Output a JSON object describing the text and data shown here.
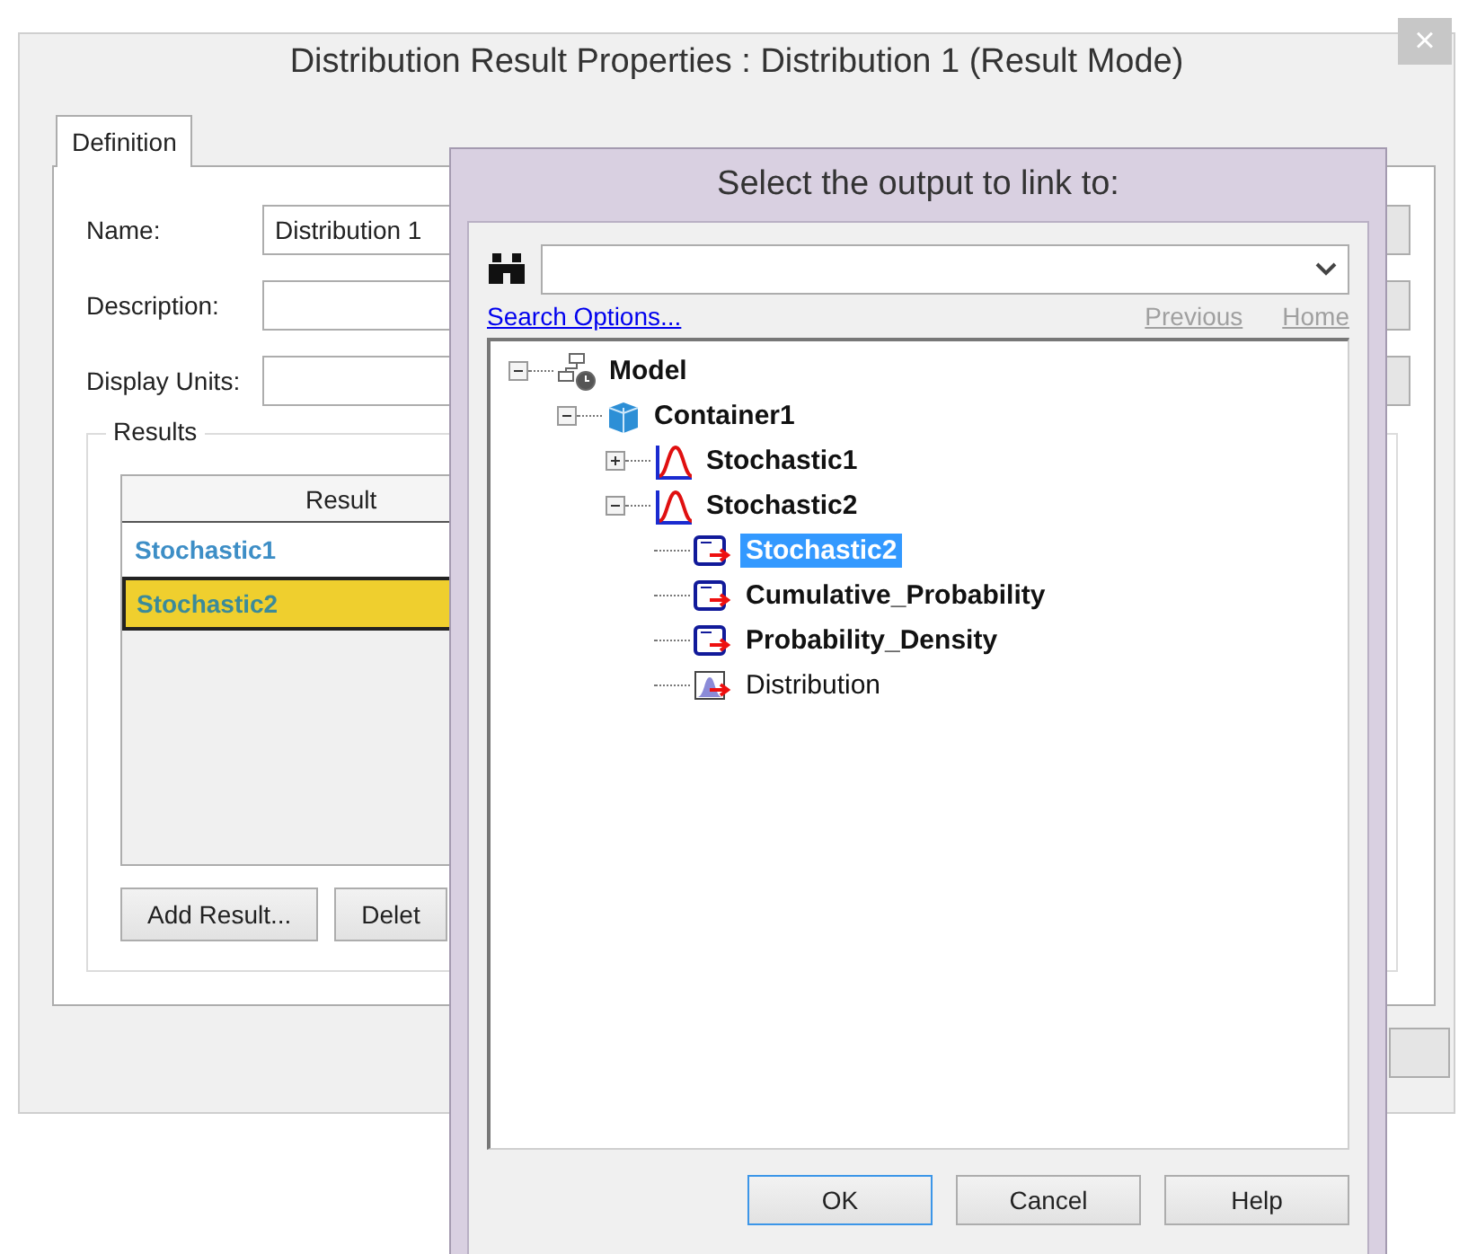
{
  "window": {
    "title": "Distribution Result Properties : Distribution 1 (Result Mode)",
    "close": "×"
  },
  "tabs": [
    {
      "label": "Definition",
      "selected": true
    }
  ],
  "fields": [
    {
      "label": "Name:",
      "value": "Distribution 1"
    },
    {
      "label": "Description:"
    },
    {
      "label": "Display Units:"
    }
  ],
  "results": {
    "title": "Results",
    "column": "Result",
    "rows": [
      {
        "label": "Stochastic1",
        "selected": false
      },
      {
        "label": "Stochastic2",
        "selected": true
      }
    ],
    "buttons": [
      "Add Result...",
      "Delet"
    ]
  },
  "dialog": {
    "title": "Select the output to link to:",
    "search_options": "Search Options...",
    "previous": "Previous",
    "home": "Home",
    "tree": [
      {
        "label": "Model",
        "kind": "model",
        "expanded": true,
        "selected": false,
        "children": [
          {
            "label": "Container1",
            "kind": "container",
            "expanded": true,
            "selected": false,
            "children": [
              {
                "label": "Stochastic1",
                "kind": "stochastic",
                "expanded": false,
                "selected": false
              },
              {
                "label": "Stochastic2",
                "kind": "stochastic",
                "expanded": true,
                "selected": false,
                "children": [
                  {
                    "label": "Stochastic2",
                    "kind": "output",
                    "selected": true
                  },
                  {
                    "label": "Cumulative_Probability",
                    "kind": "output",
                    "selected": false
                  },
                  {
                    "label": "Probability_Density",
                    "kind": "output",
                    "selected": false
                  },
                  {
                    "label": "Distribution",
                    "kind": "distribution",
                    "selected": false
                  }
                ]
              }
            ]
          }
        ]
      }
    ],
    "buttons": [
      {
        "label": "OK",
        "default": true
      },
      {
        "label": "Cancel",
        "default": false
      },
      {
        "label": "Help",
        "default": false
      }
    ]
  }
}
